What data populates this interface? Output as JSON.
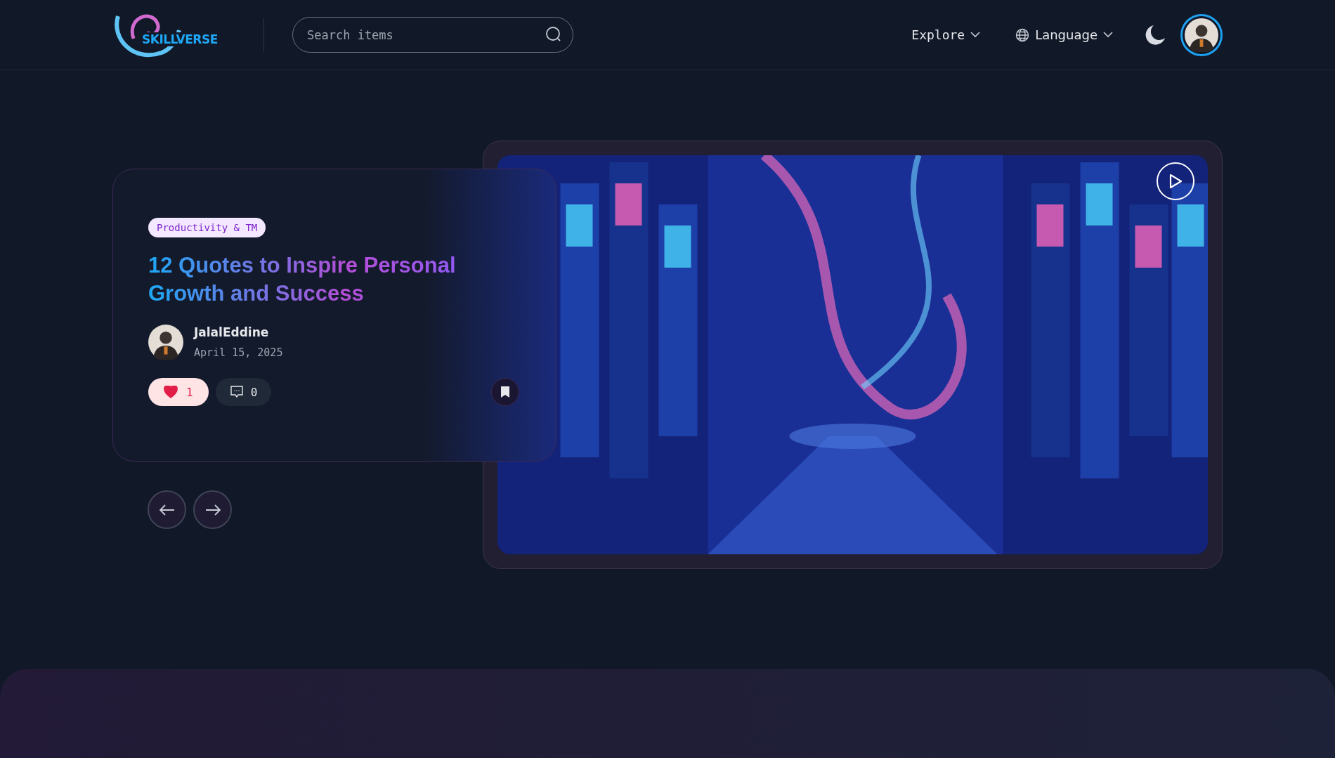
{
  "header": {
    "logo_text": "SKILLVERSE",
    "search": {
      "placeholder": "Search items"
    },
    "nav": [
      {
        "kind": "menu",
        "label": "Explore"
      },
      {
        "kind": "language",
        "label": "Language"
      }
    ]
  },
  "featured": {
    "category": "Productivity & TM",
    "title": "12 Quotes to Inspire Personal Growth and Success",
    "author": "JalalEddine",
    "date": "April 15, 2025",
    "likes": {
      "count": "1",
      "liked": true
    },
    "comments": {
      "count": "0"
    }
  }
}
